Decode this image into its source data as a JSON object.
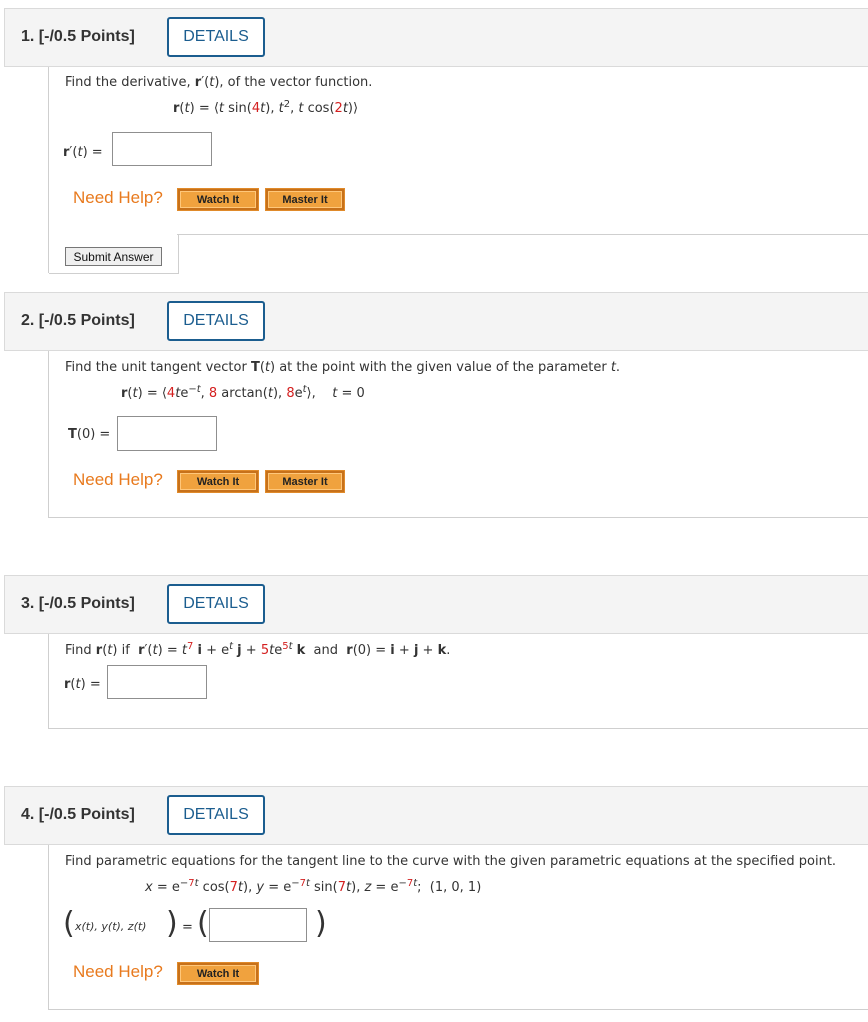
{
  "details_label": "DETAILS",
  "need_help": "Need Help?",
  "watch_it": "Watch It",
  "master_it": "Master It",
  "submit_answer": "Submit Answer",
  "q1": {
    "number": "1. [-/0.5 Points]",
    "prompt_a": "Find the derivative, ",
    "prompt_b": "r",
    "prompt_c": "′(",
    "prompt_d": "t",
    "prompt_e": "), of the vector function.",
    "answer_label": "r′(t) ="
  },
  "q2": {
    "number": "2. [-/0.5 Points]",
    "prompt_a": "Find the unit tangent vector ",
    "prompt_b": "T",
    "prompt_c": "(",
    "prompt_d": "t",
    "prompt_e": ") at the point with the given value of the parameter ",
    "prompt_f": "t",
    "prompt_g": ".",
    "answer_label": "T(0) ="
  },
  "q3": {
    "number": "3. [-/0.5 Points]",
    "answer_label": "r(t) ="
  },
  "q4": {
    "number": "4. [-/0.5 Points]",
    "prompt": "Find parametric equations for the tangent line to the curve with the given parametric equations at the specified point.",
    "answer_label": "x(t), y(t), z(t)"
  },
  "colors": {
    "details_border": "#1b5d8f",
    "need_help": "#e87a1e",
    "help_button": "#f0a23e",
    "highlight_red": "#d42020"
  }
}
